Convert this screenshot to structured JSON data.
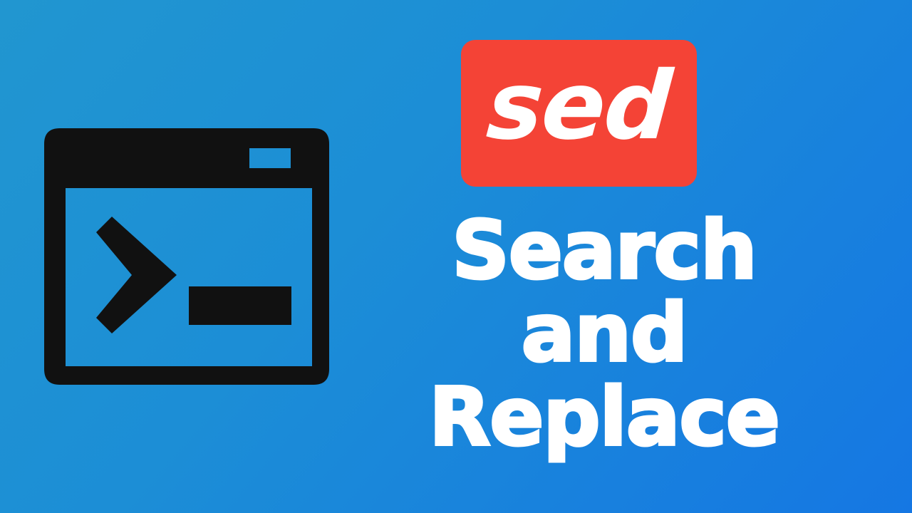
{
  "badge": {
    "label": "sed",
    "color": "#f44336"
  },
  "headline": {
    "line1": "Search",
    "line2": "and",
    "line3": "Replace"
  },
  "terminal_icon": {
    "name": "terminal-window-icon"
  },
  "colors": {
    "background_start": "#2196d0",
    "background_end": "#1577e3",
    "icon": "#111111",
    "text": "#ffffff"
  }
}
